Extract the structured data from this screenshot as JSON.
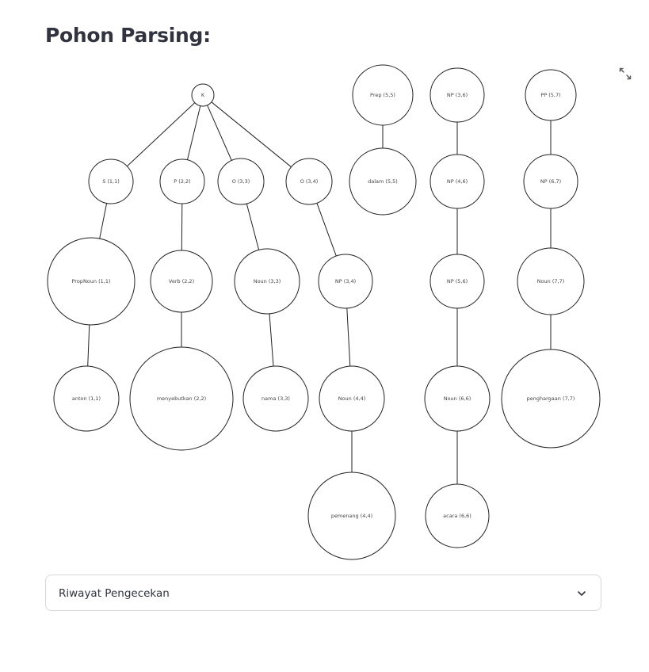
{
  "page": {
    "title": "Pohon Parsing:"
  },
  "toolbar": {
    "fullscreen_icon": "expand-arrows-icon"
  },
  "tree": {
    "nodes": [
      {
        "id": "K",
        "label": "K"
      },
      {
        "id": "S11",
        "label": "S (1,1)"
      },
      {
        "id": "P22",
        "label": "P (2,2)"
      },
      {
        "id": "O33",
        "label": "O (3,3)"
      },
      {
        "id": "O34",
        "label": "O (3,4)"
      },
      {
        "id": "PropNoun11",
        "label": "PropNoun (1,1)"
      },
      {
        "id": "Verb22",
        "label": "Verb (2,2)"
      },
      {
        "id": "Noun33",
        "label": "Noun (3,3)"
      },
      {
        "id": "NP34",
        "label": "NP (3,4)"
      },
      {
        "id": "anton11",
        "label": "anton (1,1)"
      },
      {
        "id": "menyebutkan22",
        "label": "menyebutkan (2,2)"
      },
      {
        "id": "nama33",
        "label": "nama (3,3)"
      },
      {
        "id": "Noun44",
        "label": "Noun (4,4)"
      },
      {
        "id": "pemenang44",
        "label": "pemenang (4,4)"
      },
      {
        "id": "Prep55",
        "label": "Prep (5,5)"
      },
      {
        "id": "dalam55",
        "label": "dalam (5,5)"
      },
      {
        "id": "NP36",
        "label": "NP (3,6)"
      },
      {
        "id": "NP46",
        "label": "NP (4,6)"
      },
      {
        "id": "NP56",
        "label": "NP (5,6)"
      },
      {
        "id": "Noun66",
        "label": "Noun (6,6)"
      },
      {
        "id": "acara66",
        "label": "acara (6,6)"
      },
      {
        "id": "PP57",
        "label": "PP (5,7)"
      },
      {
        "id": "NP67",
        "label": "NP (6,7)"
      },
      {
        "id": "Noun77",
        "label": "Noun (7,7)"
      },
      {
        "id": "penghargaan77",
        "label": "penghargaan (7,7)"
      }
    ],
    "edges": [
      [
        "K",
        "S11"
      ],
      [
        "K",
        "P22"
      ],
      [
        "K",
        "O33"
      ],
      [
        "K",
        "O34"
      ],
      [
        "S11",
        "PropNoun11"
      ],
      [
        "P22",
        "Verb22"
      ],
      [
        "O33",
        "Noun33"
      ],
      [
        "O34",
        "NP34"
      ],
      [
        "PropNoun11",
        "anton11"
      ],
      [
        "Verb22",
        "menyebutkan22"
      ],
      [
        "Noun33",
        "nama33"
      ],
      [
        "NP34",
        "Noun44"
      ],
      [
        "Noun44",
        "pemenang44"
      ],
      [
        "Prep55",
        "dalam55"
      ],
      [
        "NP36",
        "NP46"
      ],
      [
        "NP46",
        "NP56"
      ],
      [
        "NP56",
        "Noun66"
      ],
      [
        "Noun66",
        "acara66"
      ],
      [
        "PP57",
        "NP67"
      ],
      [
        "NP67",
        "Noun77"
      ],
      [
        "Noun77",
        "penghargaan77"
      ]
    ]
  },
  "expander": {
    "label": "Riwayat Pengecekan",
    "icon": "chevron-down-icon"
  }
}
